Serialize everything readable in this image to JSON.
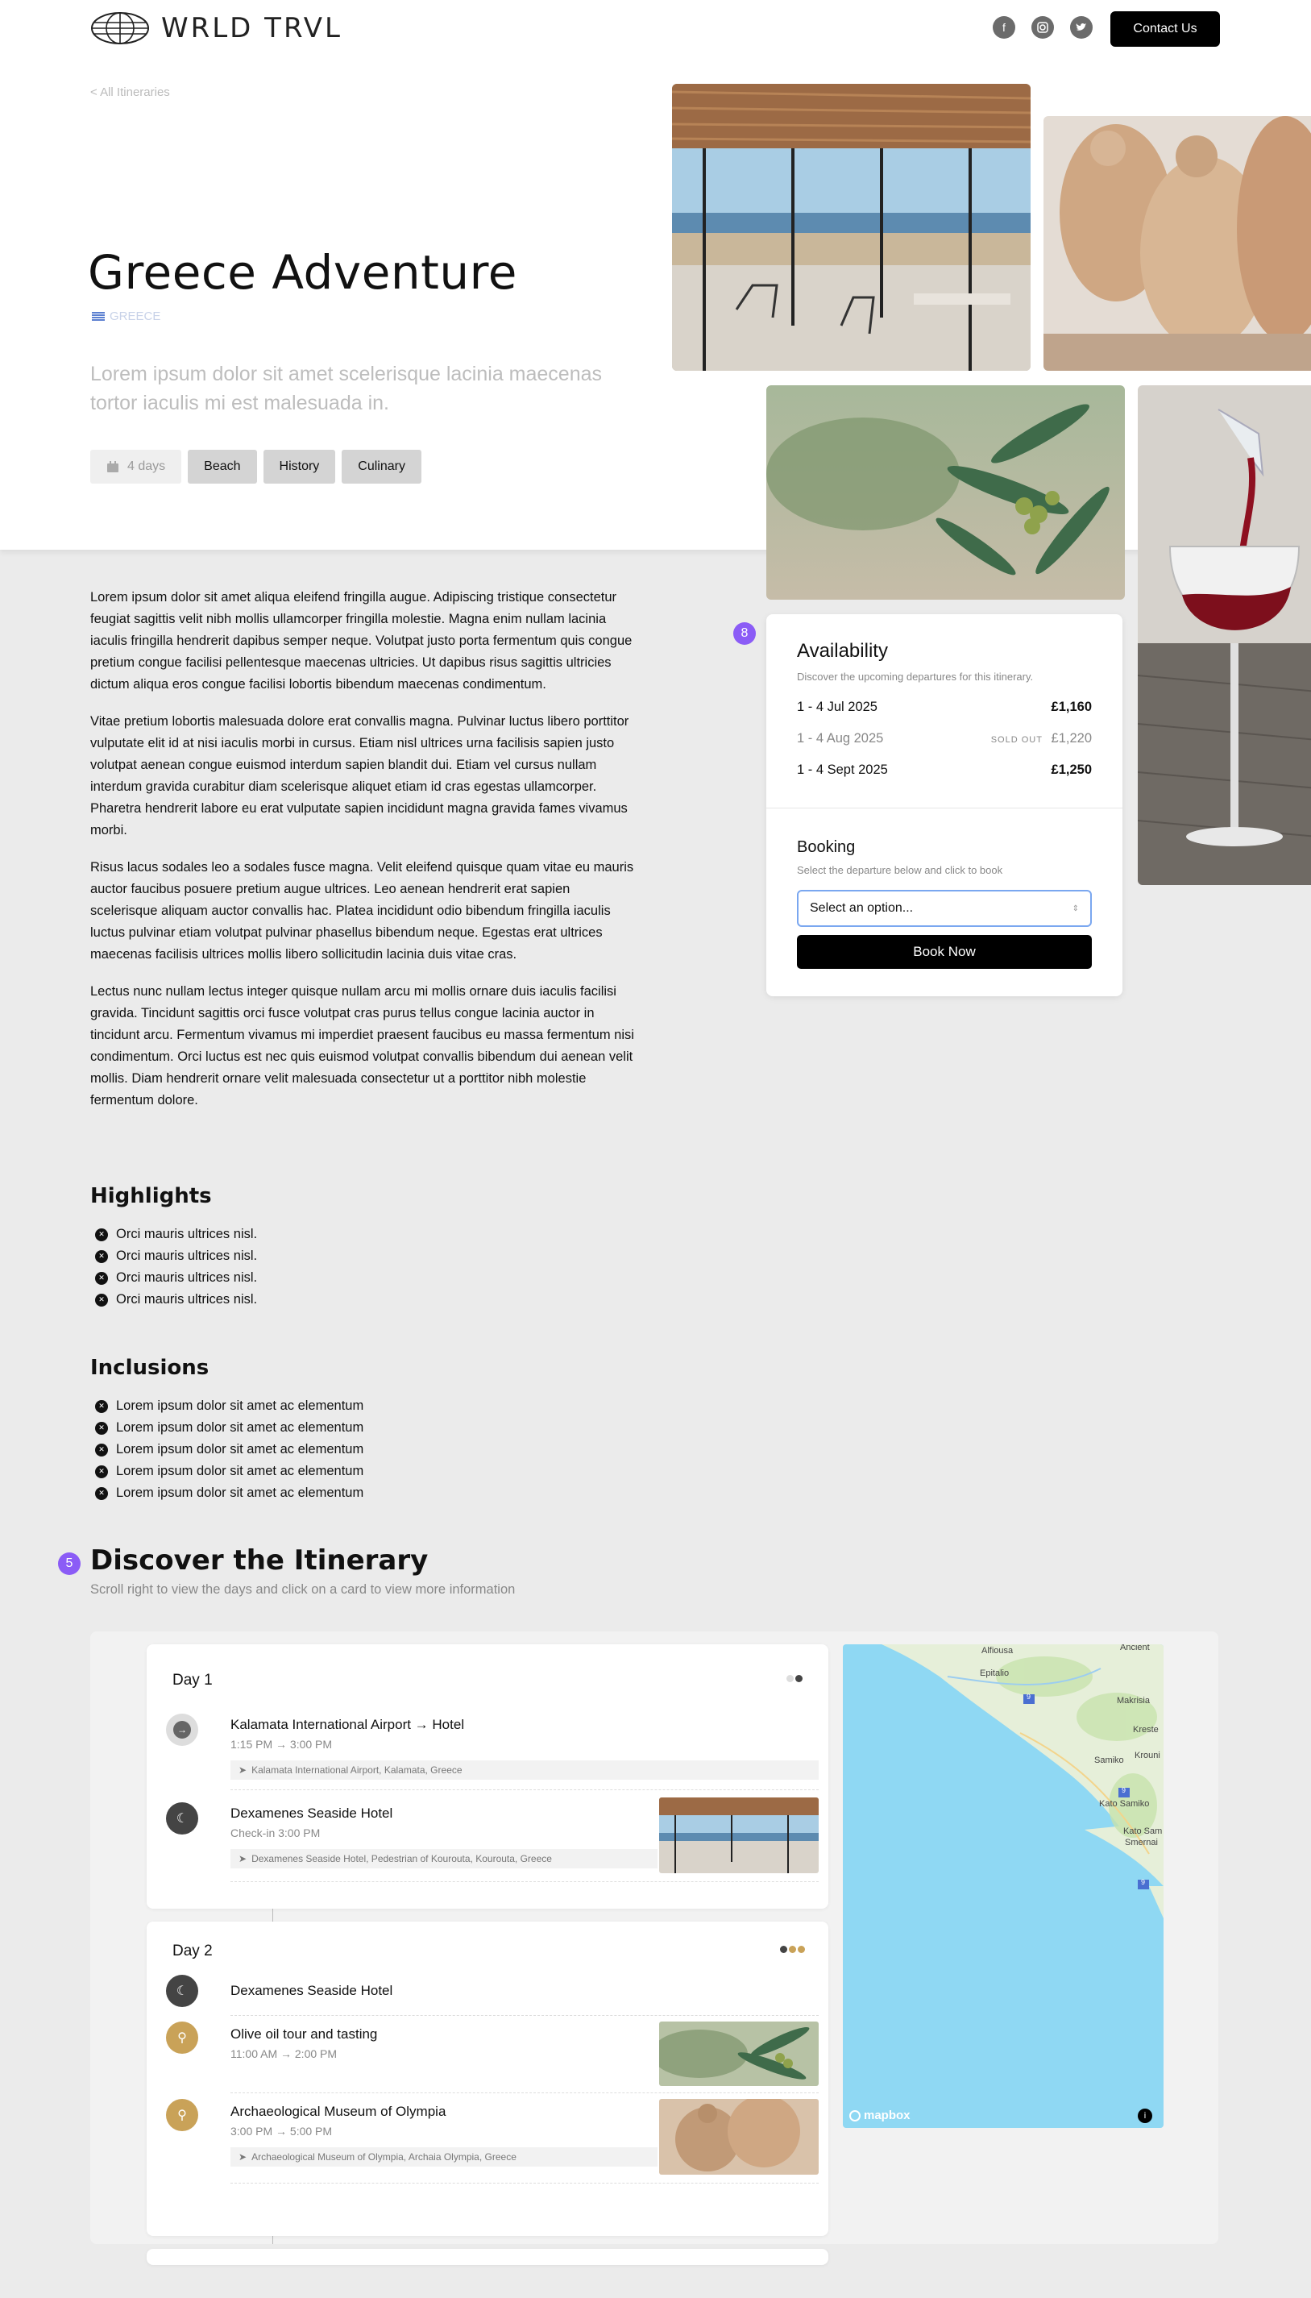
{
  "header": {
    "logo_text": "WRLD TRVL",
    "contact_label": "Contact Us",
    "social_icons": [
      "facebook-icon",
      "instagram-icon",
      "twitter-icon"
    ]
  },
  "trip": {
    "back_link": "< All Itineraries",
    "title": "Greece Adventure",
    "country": "GREECE",
    "lede": "Lorem ipsum dolor sit amet scelerisque lacinia maecenas tortor iaculis mi est malesuada in.",
    "duration": "4 days",
    "tags": [
      "Beach",
      "History",
      "Culinary"
    ]
  },
  "body": {
    "paragraphs": [
      "Lorem ipsum dolor sit amet aliqua eleifend fringilla augue. Adipiscing tristique consectetur feugiat sagittis velit nibh mollis ullamcorper fringilla molestie. Magna enim nullam lacinia iaculis fringilla hendrerit dapibus semper neque. Volutpat justo porta fermentum quis congue pretium congue facilisi pellentesque maecenas ultricies. Ut dapibus risus sagittis ultricies dictum aliqua eros congue facilisi lobortis bibendum maecenas condimentum.",
      "Vitae pretium lobortis malesuada dolore erat convallis magna. Pulvinar luctus libero porttitor vulputate elit id at nisi iaculis morbi in cursus. Etiam nisl ultrices urna facilisis sapien justo volutpat aenean congue euismod interdum sapien blandit dui. Etiam vel cursus nullam interdum gravida curabitur diam scelerisque aliquet etiam id cras egestas ullamcorper. Pharetra hendrerit labore eu erat vulputate sapien incididunt magna gravida fames vivamus morbi.",
      "Risus lacus sodales leo a sodales fusce magna. Velit eleifend quisque quam vitae eu mauris auctor faucibus posuere pretium augue ultrices. Leo aenean hendrerit erat sapien scelerisque aliquam auctor convallis hac. Platea incididunt odio bibendum fringilla iaculis luctus pulvinar etiam volutpat pulvinar phasellus bibendum neque. Egestas erat ultrices maecenas facilisis ultrices mollis libero sollicitudin lacinia duis vitae cras.",
      "Lectus nunc nullam lectus integer quisque nullam arcu mi mollis ornare duis iaculis facilisi gravida. Tincidunt sagittis orci fusce volutpat cras purus tellus congue lacinia auctor in tincidunt arcu. Fermentum vivamus mi imperdiet praesent faucibus eu massa fermentum nisi condimentum. Orci luctus est nec quis euismod volutpat convallis bibendum dui aenean velit mollis. Diam hendrerit ornare velit malesuada consectetur ut a porttitor nibh molestie fermentum dolore."
    ],
    "highlights_title": "Highlights",
    "highlights": [
      "Orci mauris ultrices nisl.",
      "Orci mauris ultrices nisl.",
      "Orci mauris ultrices nisl.",
      "Orci mauris ultrices nisl."
    ],
    "inclusions_title": "Inclusions",
    "inclusions": [
      "Lorem ipsum dolor sit amet ac elementum",
      "Lorem ipsum dolor sit amet ac elementum",
      "Lorem ipsum dolor sit amet ac elementum",
      "Lorem ipsum dolor sit amet ac elementum",
      "Lorem ipsum dolor sit amet ac elementum"
    ]
  },
  "availability": {
    "badge": "8",
    "title": "Availability",
    "subtitle": "Discover the upcoming departures for this itinerary.",
    "departures": [
      {
        "dates": "1 - 4 Jul 2025",
        "price": "£1,160",
        "status": ""
      },
      {
        "dates": "1 - 4 Aug 2025",
        "price": "£1,220",
        "status": "SOLD OUT"
      },
      {
        "dates": "1 - 4 Sept 2025",
        "price": "£1,250",
        "status": ""
      }
    ],
    "booking_title": "Booking",
    "booking_subtitle": "Select the departure below and click to book",
    "select_placeholder": "Select an option...",
    "book_label": "Book Now"
  },
  "itinerary": {
    "badge": "5",
    "title": "Discover the Itinerary",
    "subtitle": "Scroll right to view the days and click on a card to view more information",
    "days": [
      {
        "label": "Day 1",
        "stops": [
          {
            "title": "Kalamata International Airport → Hotel",
            "time": "1:15 PM → 3:00 PM",
            "location": "Kalamata International Airport, Kalamata, Greece"
          },
          {
            "title": "Dexamenes Seaside Hotel",
            "time": "Check-in 3:00 PM",
            "location": "Dexamenes Seaside Hotel, Pedestrian of Kourouta, Kourouta, Greece"
          }
        ]
      },
      {
        "label": "Day 2",
        "stops": [
          {
            "title": "Dexamenes Seaside Hotel",
            "time": "",
            "location": ""
          },
          {
            "title": "Olive oil tour and tasting",
            "time": "11:00 AM → 2:00 PM",
            "location": ""
          },
          {
            "title": "Archaeological Museum of Olympia",
            "time": "3:00 PM → 5:00 PM",
            "location": "Archaeological Museum of Olympia, Archaia Olympia, Greece"
          }
        ]
      }
    ],
    "map": {
      "places": [
        "Ancient",
        "Alfiousa",
        "Epitalio",
        "Makrisia",
        "Kreste",
        "Samiko",
        "Krouni",
        "Kato Samiko",
        "Kato Sam",
        "Smernai"
      ],
      "attribution": "mapbox",
      "road_labels": [
        "9",
        "9",
        "9"
      ]
    }
  },
  "colors": {
    "accent_badge": "#8b5cf6",
    "hero_bg": "#ffffff",
    "page_bg": "#ebebeb",
    "button": "#000000",
    "sea": "#8fd8f3",
    "day_icon_gold": "#c9a258"
  }
}
